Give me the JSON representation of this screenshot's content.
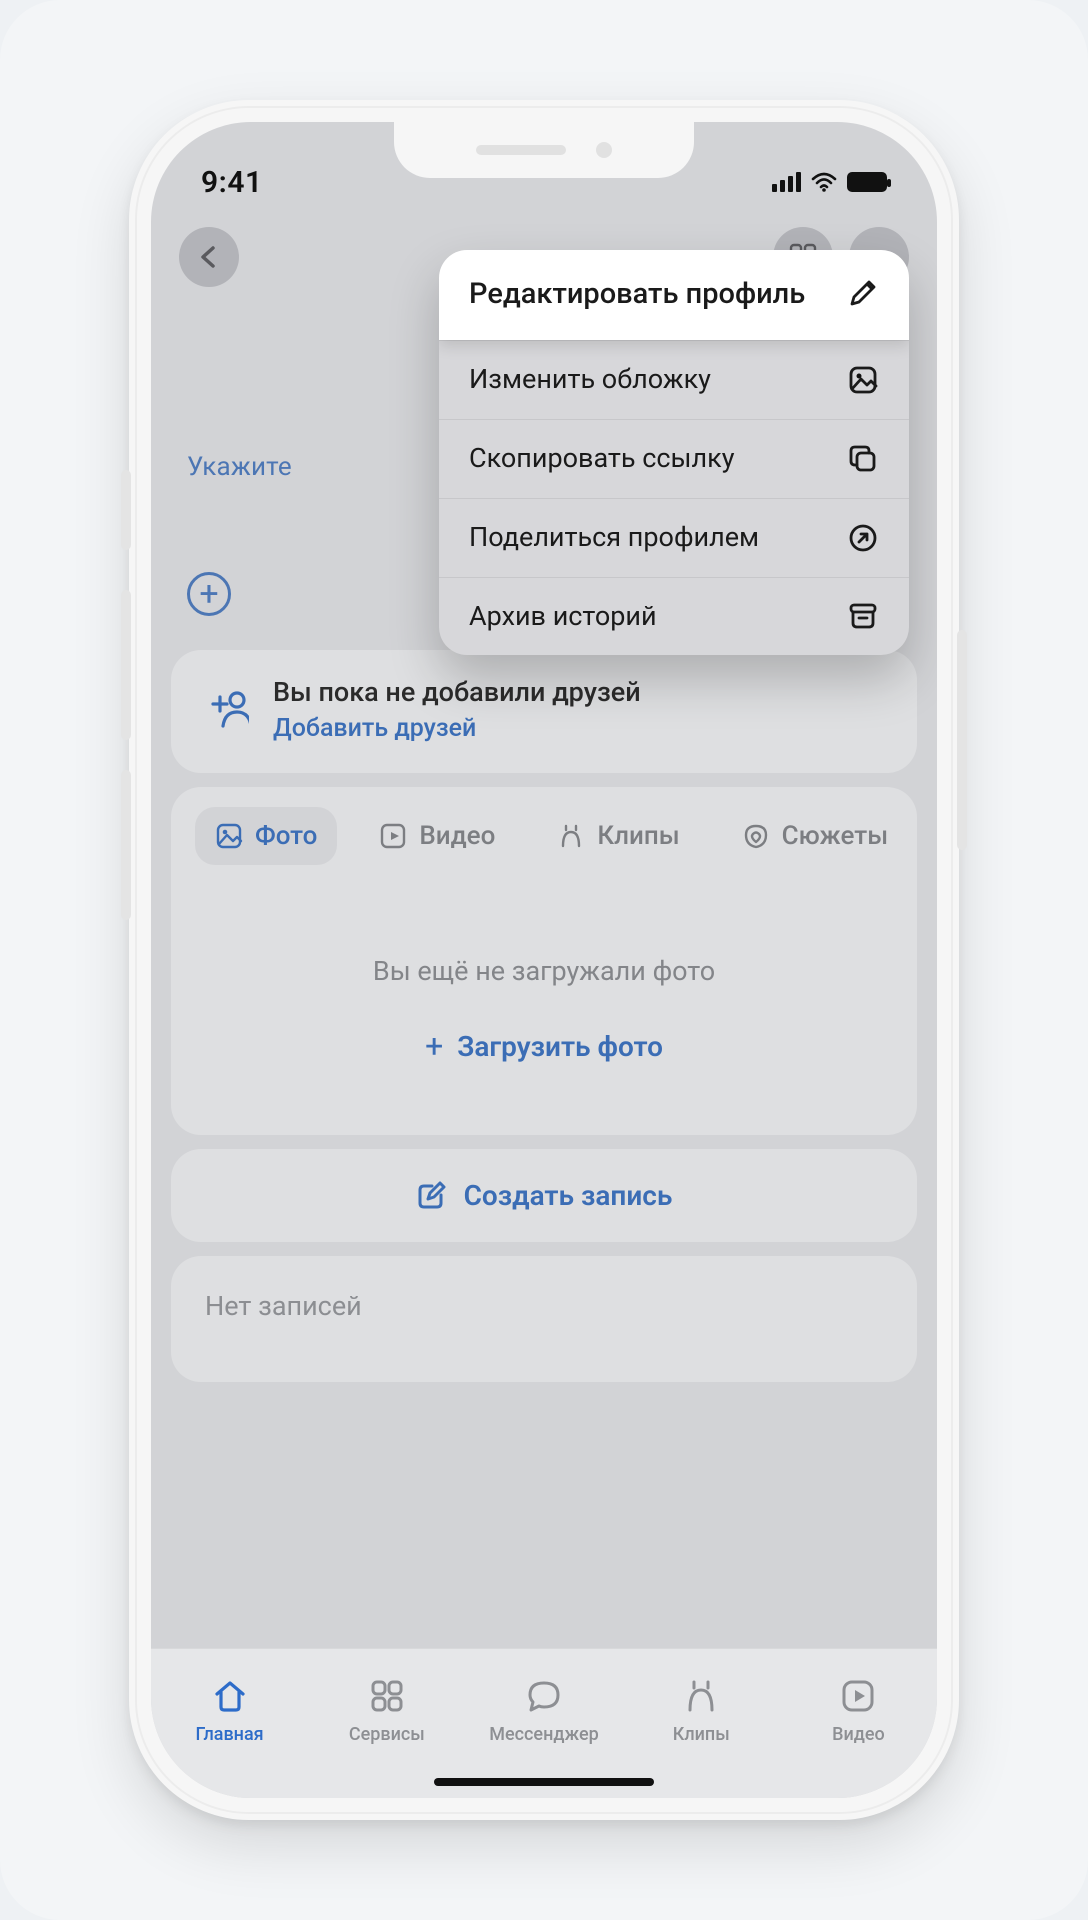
{
  "status": {
    "time": "9:41"
  },
  "menu": {
    "edit_profile": "Редактировать профиль",
    "change_cover": "Изменить обложку",
    "copy_link": "Скопировать ссылку",
    "share_profile": "Поделиться профилем",
    "story_archive": "Архив историй"
  },
  "profile": {
    "hint_visible": "Укажите"
  },
  "friends_card": {
    "title": "Вы пока не добавили друзей",
    "action": "Добавить друзей"
  },
  "media_tabs": {
    "photo": "Фото",
    "video": "Видео",
    "clips": "Клипы",
    "stories": "Сюжеты"
  },
  "empty_photos": {
    "message": "Вы ещё не загружали фото",
    "action": "Загрузить фото"
  },
  "compose": {
    "label": "Создать запись"
  },
  "posts": {
    "empty": "Нет записей"
  },
  "tabbar": {
    "home": "Главная",
    "services": "Сервисы",
    "messenger": "Мессенджер",
    "clips": "Клипы",
    "video": "Видео"
  },
  "colors": {
    "accent": "#3b6db5"
  }
}
